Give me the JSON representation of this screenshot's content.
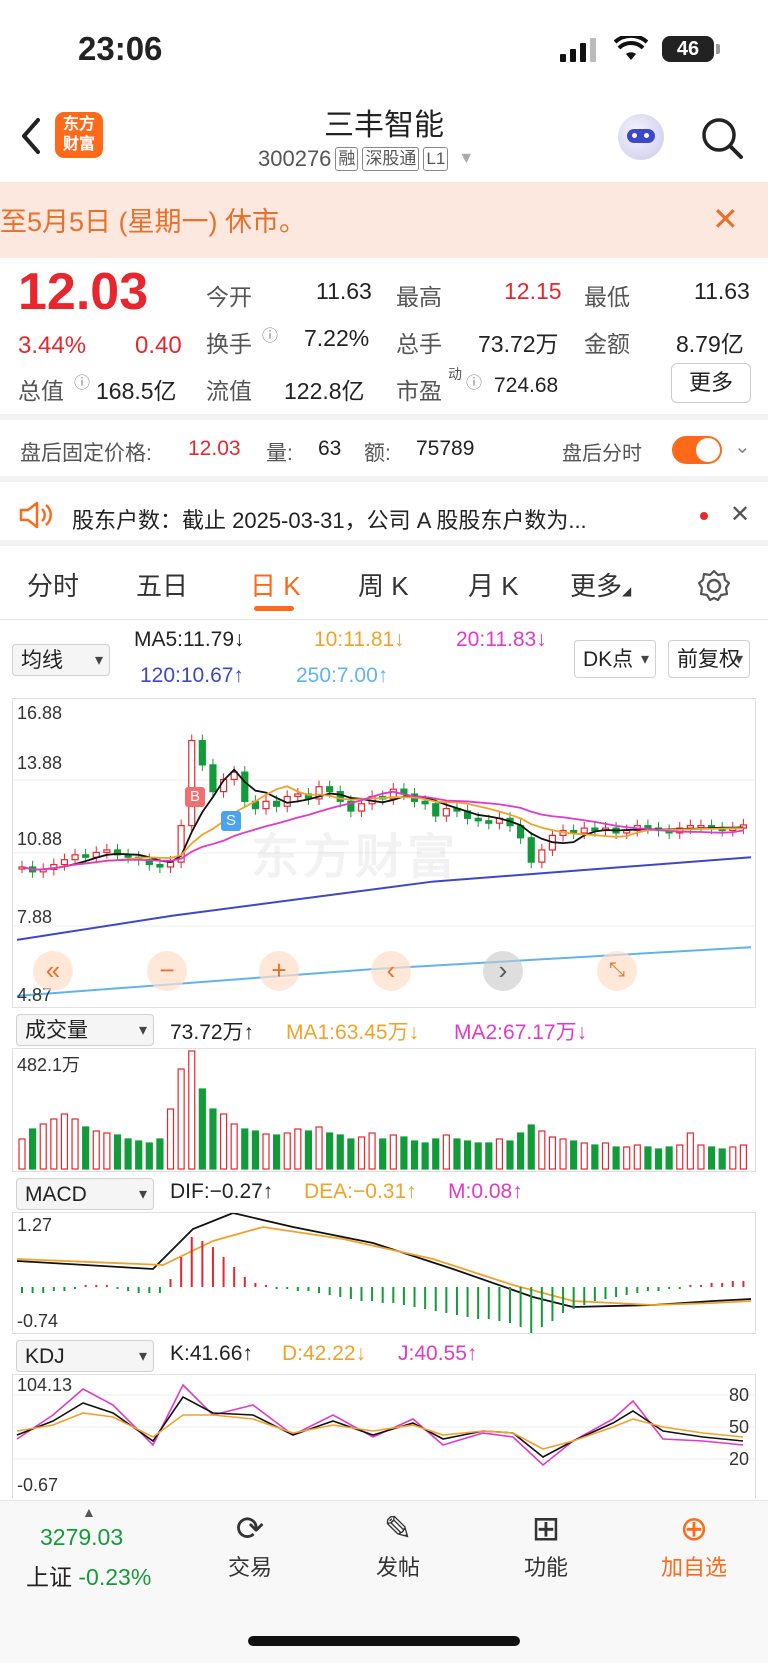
{
  "status": {
    "time": "23:06",
    "battery": "46"
  },
  "header": {
    "logo": "东方\n财富",
    "title": "三丰智能",
    "code": "300276",
    "tags": [
      "融",
      "深股通",
      "L1"
    ]
  },
  "banner": {
    "text": "至5月5日 (星期一) 休市。"
  },
  "quote": {
    "price": "12.03",
    "pct": "3.44%",
    "chg": "0.40",
    "open_label": "今开",
    "open": "11.63",
    "high_label": "最高",
    "high": "12.15",
    "low_label": "最低",
    "low": "11.63",
    "turnover_label": "换手",
    "turnover": "7.22%",
    "volume_label": "总手",
    "volume": "73.72万",
    "amount_label": "金额",
    "amount": "8.79亿",
    "mktcap_label": "总值",
    "mktcap": "168.5亿",
    "float_label": "流值",
    "float": "122.8亿",
    "pe_label": "市盈",
    "pe_sup": "动",
    "pe": "724.68",
    "more": "更多"
  },
  "after_hours": {
    "label": "盘后固定价格:",
    "price": "12.03",
    "vol_label": "量:",
    "vol": "63",
    "amt_label": "额:",
    "amt": "75789",
    "switch_label": "盘后分时"
  },
  "notice": {
    "text": "股东户数：截止 2025-03-31，公司 A 股股东户数为..."
  },
  "tabs": [
    "分时",
    "五日",
    "日 K",
    "周 K",
    "月 K",
    "更多"
  ],
  "kline": {
    "ma_select": "均线",
    "ma5": "MA5:11.79↓",
    "ma10": "10:11.81↓",
    "ma20": "20:11.83↓",
    "ma120": "120:10.67↑",
    "ma250": "250:7.00↑",
    "dk": "DK点",
    "fq": "前复权",
    "y_labels": [
      "16.88",
      "13.88",
      "10.88",
      "7.88",
      "4.87"
    ],
    "watermark": "东方财富",
    "buy_mark": "B",
    "sell_mark": "S",
    "colors": {
      "up": "#e8262d",
      "down": "#139b3a",
      "ma5": "#111111",
      "ma10": "#f0a22a",
      "ma20": "#e03ac9",
      "ma120": "#3c48c6",
      "ma250": "#5fb4f0"
    }
  },
  "volume": {
    "select": "成交量",
    "value": "73.72万↑",
    "ma1": "MA1:63.45万↓",
    "ma2": "MA2:67.17万↓",
    "y_max": "482.1万"
  },
  "macd": {
    "select": "MACD",
    "dif": "DIF:−0.27↑",
    "dea": "DEA:−0.31↑",
    "m": "M:0.08↑",
    "y_max": "1.27",
    "y_min": "-0.74"
  },
  "kdj": {
    "select": "KDJ",
    "k": "K:41.66↑",
    "d": "D:42.22↓",
    "j": "J:40.55↑",
    "y_max": "104.13",
    "y_min": "-0.67",
    "levels": [
      "80",
      "50",
      "20"
    ]
  },
  "bottom_nav": {
    "index_value": "3279.03",
    "index_name": "上证",
    "index_pct": "-0.23%",
    "items": [
      "交易",
      "发帖",
      "功能",
      "加自选"
    ]
  }
}
